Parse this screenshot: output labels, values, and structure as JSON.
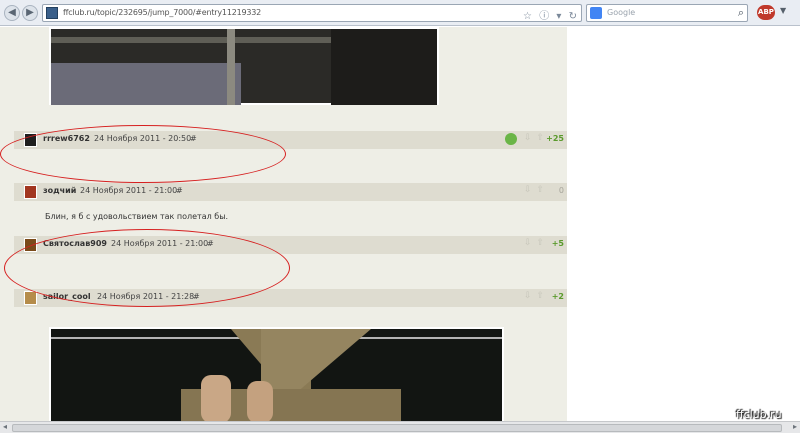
{
  "browser": {
    "back_icon": "back-arrow-icon",
    "forward_icon": "forward-arrow-icon",
    "url": "ffclub.ru/topic/232695/jump_7000/#entry11219332",
    "search_placeholder": "Google",
    "addon_label": "ABP"
  },
  "posts": [
    {
      "author": "rrrew6762",
      "date": "24 Ноября 2011 - 20:50",
      "anchor": "#",
      "score": "+25",
      "body": ""
    },
    {
      "author": "зодчий",
      "date": "24 Ноября 2011 - 21:00",
      "anchor": "#",
      "score": "0",
      "body": "Блин, я б с удовольствием так полетал бы."
    },
    {
      "author": "Святослав909",
      "date": "24 Ноября 2011 - 21:00",
      "anchor": "#",
      "score": "+5",
      "body": ""
    },
    {
      "author": "sailor_cool",
      "date": "24 Ноября 2011 - 21:28",
      "anchor": "#",
      "score": "+2",
      "body": ""
    }
  ],
  "vote_arrows": "⇩ ⇧",
  "watermark": "ffclub.ru",
  "colors": {
    "column_bg": "#eeeee6",
    "header_bg": "#dedcd0",
    "score_green": "#5a9a2c",
    "ellipse_red": "#d62020"
  }
}
